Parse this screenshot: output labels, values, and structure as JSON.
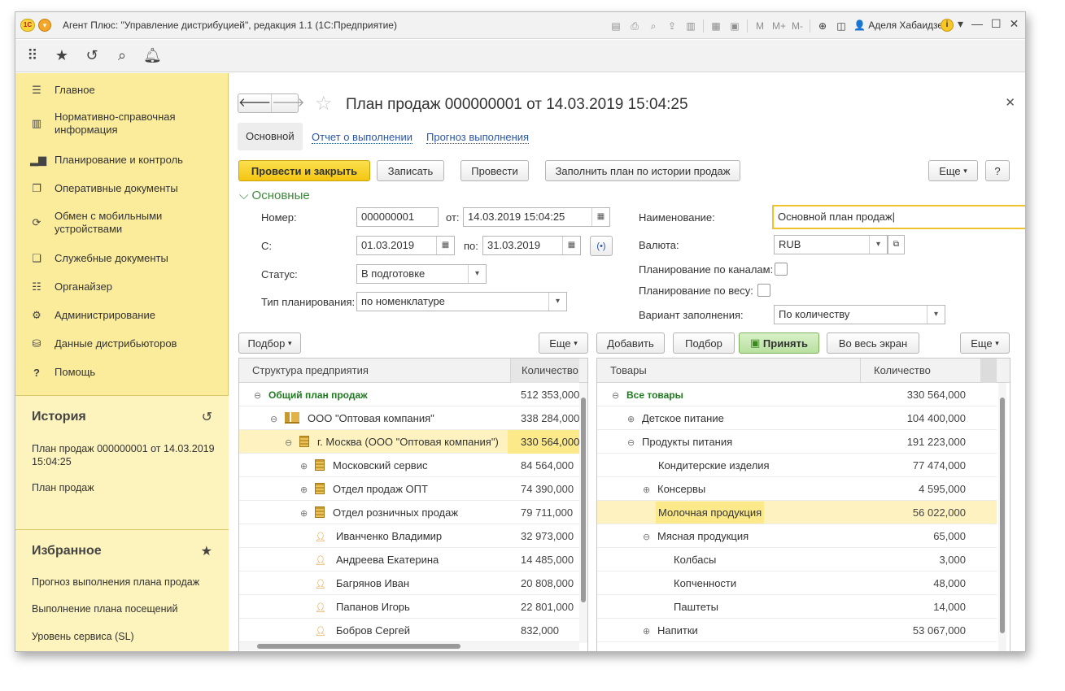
{
  "window": {
    "title": "Агент Плюс: \"Управление дистрибуцией\", редакция 1.1  (1С:Предприятие)",
    "user": "Аделя Хабаидзе",
    "toolbar_letters": [
      "M",
      "M+",
      "M-"
    ]
  },
  "sidebar": {
    "items": [
      {
        "icon": "menu-icon",
        "label": "Главное"
      },
      {
        "icon": "reference-icon",
        "label": "Нормативно-справочная информация"
      },
      {
        "icon": "chart-icon",
        "label": "Планирование и контроль"
      },
      {
        "icon": "documents-icon",
        "label": "Оперативные документы"
      },
      {
        "icon": "sync-icon",
        "label": "Обмен с мобильными устройствами"
      },
      {
        "icon": "service-docs-icon",
        "label": "Служебные документы"
      },
      {
        "icon": "organizer-icon",
        "label": "Органайзер"
      },
      {
        "icon": "gear-icon",
        "label": "Администрирование"
      },
      {
        "icon": "distributors-icon",
        "label": "Данные дистрибьюторов"
      },
      {
        "icon": "help-icon",
        "label": "Помощь"
      }
    ],
    "history": {
      "title": "История",
      "links": [
        "План продаж 000000001 от 14.03.2019 15:04:25",
        "План продаж"
      ]
    },
    "favorites": {
      "title": "Избранное",
      "links": [
        "Прогноз выполнения плана продаж",
        "Выполнение плана посещений",
        "Уровень сервиса (SL)"
      ]
    }
  },
  "form": {
    "title": "План продаж 000000001 от 14.03.2019 15:04:25",
    "tabs": [
      "Основной",
      "Отчет о выполнении",
      "Прогноз выполнения"
    ],
    "buttons": {
      "post_close": "Провести и закрыть",
      "save": "Записать",
      "post": "Провести",
      "fill_history": "Заполнить план по истории продаж",
      "more": "Еще",
      "help": "?"
    },
    "section": "Основные",
    "fields": {
      "number_label": "Номер:",
      "number": "000000001",
      "from_label": "от:",
      "from_date": "14.03.2019 15:04:25",
      "start_label": "С:",
      "start_date": "01.03.2019",
      "end_label": "по:",
      "end_date": "31.03.2019",
      "status_label": "Статус:",
      "status": "В подготовке",
      "plan_type_label": "Тип планирования:",
      "plan_type": "по номенклатуре",
      "name_label": "Наименование:",
      "name": "Основной план продаж",
      "currency_label": "Валюта:",
      "currency": "RUB",
      "by_channels_label": "Планирование по каналам:",
      "by_weight_label": "Планирование по весу:",
      "fill_variant_label": "Вариант заполнения:",
      "fill_variant": "По количеству"
    }
  },
  "left_table": {
    "buttons": {
      "select": "Подбор",
      "more": "Еще"
    },
    "headers": [
      "Структура предприятия",
      "Количество"
    ],
    "rows": [
      {
        "name": "Общий план продаж",
        "value": "512 353,000"
      },
      {
        "name": "ООО \"Оптовая компания\"",
        "value": "338 284,000"
      },
      {
        "name": "г. Москва  (ООО \"Оптовая компания\")",
        "value": "330 564,000"
      },
      {
        "name": "Московский сервис",
        "value": "84 564,000"
      },
      {
        "name": "Отдел продаж ОПТ",
        "value": "74 390,000"
      },
      {
        "name": "Отдел розничных продаж",
        "value": "79 711,000"
      },
      {
        "name": "Иванченко Владимир",
        "value": "32 973,000"
      },
      {
        "name": "Андреева Екатерина",
        "value": "14 485,000"
      },
      {
        "name": "Багрянов Иван",
        "value": "20 808,000"
      },
      {
        "name": "Папанов Игорь",
        "value": "22 801,000"
      },
      {
        "name": "Бобров Сергей",
        "value": "832,000"
      }
    ]
  },
  "right_table": {
    "buttons": {
      "add": "Добавить",
      "select": "Подбор",
      "accept": "Принять",
      "fullscreen": "Во весь экран",
      "more": "Еще"
    },
    "headers": [
      "Товары",
      "Количество"
    ],
    "rows": [
      {
        "name": "Все товары",
        "value": "330 564,000"
      },
      {
        "name": "Детское питание",
        "value": "104 400,000"
      },
      {
        "name": "Продукты питания",
        "value": "191 223,000"
      },
      {
        "name": "Кондитерские изделия",
        "value": "77 474,000"
      },
      {
        "name": "Консервы",
        "value": "4 595,000"
      },
      {
        "name": "Молочная продукция",
        "value": "56 022,000"
      },
      {
        "name": "Мясная продукция",
        "value": "65,000"
      },
      {
        "name": "Колбасы",
        "value": "3,000"
      },
      {
        "name": "Копченности",
        "value": "48,000"
      },
      {
        "name": "Паштеты",
        "value": "14,000"
      },
      {
        "name": "Напитки",
        "value": "53 067,000"
      }
    ]
  },
  "colors": {
    "accent": "#f4c512",
    "sidebar": "#fbec9c",
    "section": "#3d8a3d",
    "link": "#2a56a8"
  }
}
